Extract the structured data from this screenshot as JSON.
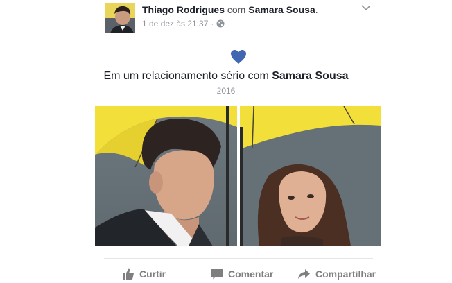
{
  "post": {
    "author": "Thiago Rodrigues",
    "connector": "com",
    "tagged": "Samara Sousa",
    "period": ".",
    "timestamp": "1 de dez às 21:37",
    "separator": "·",
    "privacy_icon": "globe-icon",
    "menu_icon": "chevron-down-icon"
  },
  "life_event": {
    "icon": "heart-icon",
    "heart_color": "#4267b2",
    "text": "Em um relacionamento sério com",
    "partner": "Samara Sousa",
    "year": "2016"
  },
  "photos": [
    {
      "name": "man-under-yellow-umbrella"
    },
    {
      "name": "woman-under-yellow-umbrella"
    }
  ],
  "actions": {
    "like_label": "Curtir",
    "comment_label": "Comentar",
    "share_label": "Compartilhar"
  },
  "colors": {
    "text_primary": "#1d2129",
    "text_secondary": "#90949c",
    "action_gray": "#7f7f7f",
    "umbrella_yellow": "#f2df3a"
  }
}
